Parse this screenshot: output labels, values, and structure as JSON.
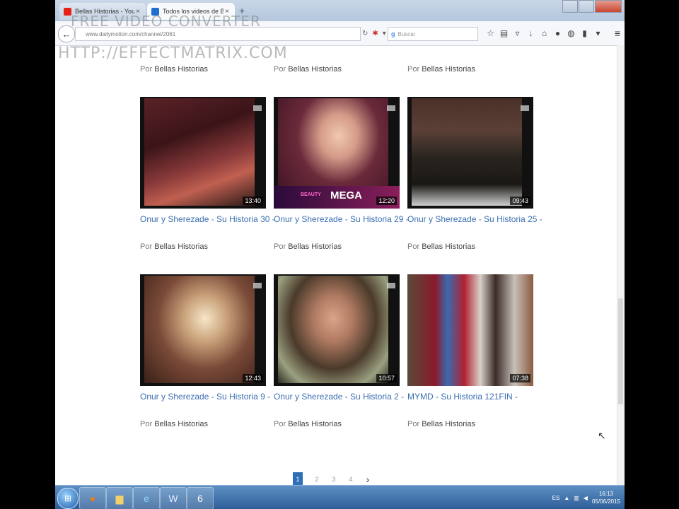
{
  "browser": {
    "tabs": [
      {
        "label": "Bellas Historias - YouTube",
        "icon": "youtube-icon",
        "active": false
      },
      {
        "label": "Todos los videos de Bellas...",
        "icon": "dailymotion-icon",
        "active": true
      }
    ],
    "new_tab_symbol": "+",
    "url": "www.dailymotion.com/channel/2061",
    "search_placeholder": "Buscar",
    "search_engine_glyph": "g",
    "menu_symbol": "≡"
  },
  "watermark": {
    "line1": "FREE VIDEO CONVERTER",
    "line2": "HTTP://EFFECTMATRIX.COM"
  },
  "content": {
    "top_bylines": [
      {
        "prefix": "Por",
        "channel": "Bellas Historias"
      },
      {
        "prefix": "Por",
        "channel": "Bellas Historias"
      },
      {
        "prefix": "Por",
        "channel": "Bellas Historias"
      }
    ],
    "videos": [
      {
        "title": "Onur y Sherezade - Su Historia 30 -",
        "duration": "13:40",
        "by_prefix": "Por",
        "channel": "Bellas Historias"
      },
      {
        "title": "Onur y Sherezade - Su Historia 29 -",
        "duration": "12:20",
        "by_prefix": "Por",
        "channel": "Bellas Historias",
        "overlay": "MEGA",
        "overlay_small": "BEAUTY"
      },
      {
        "title": "Onur y Sherezade - Su Historia 25 -",
        "duration": "09:43",
        "by_prefix": "Por",
        "channel": "Bellas Historias"
      },
      {
        "title": "Onur y Sherezade - Su Historia 9 -",
        "duration": "12:43",
        "by_prefix": "Por",
        "channel": "Bellas Historias"
      },
      {
        "title": "Onur y Sherezade - Su Historia 2 -",
        "duration": "10:57",
        "by_prefix": "Por",
        "channel": "Bellas Historias"
      },
      {
        "title": "MYMD - Su Historia 121FIN -",
        "duration": "07:38",
        "by_prefix": "Por",
        "channel": "Bellas Historias"
      }
    ],
    "pagination": {
      "pages": [
        "1",
        "2",
        "3",
        "4"
      ],
      "active": "1",
      "next": "›"
    }
  },
  "taskbar": {
    "apps": [
      "folder-icon",
      "firefox-icon",
      "explorer-icon",
      "ie-icon",
      "word-icon",
      "app-6-icon"
    ],
    "tray_lang": "ES",
    "clock_time": "16:13",
    "clock_date": "05/06/2015"
  }
}
